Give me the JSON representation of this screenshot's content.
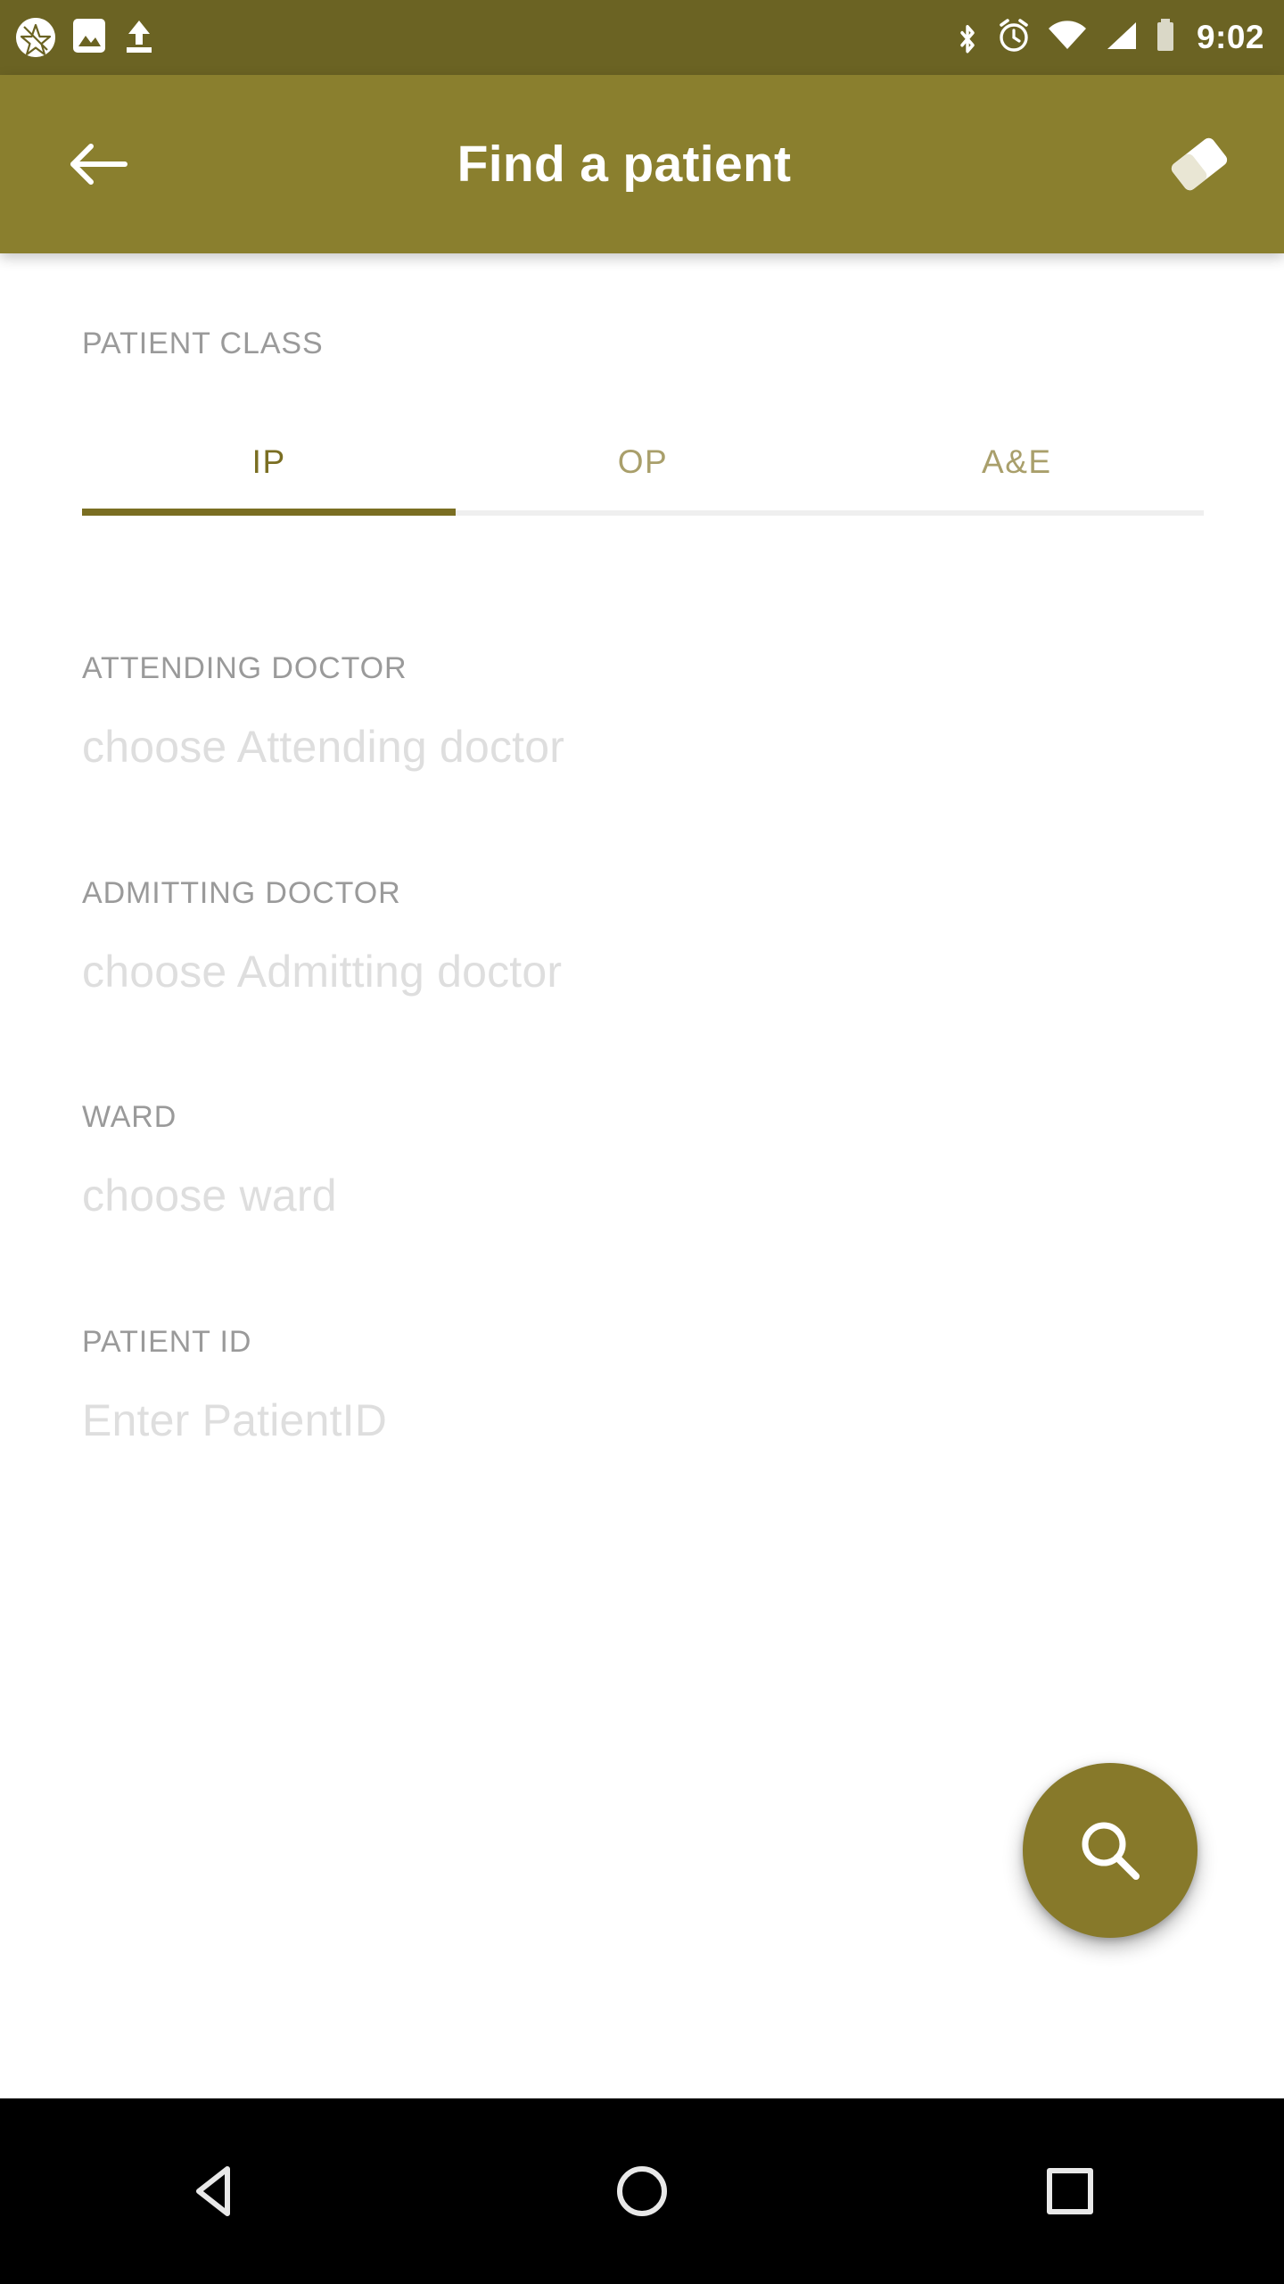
{
  "status_bar": {
    "background_color": "#6B6323",
    "time": "9:02",
    "left_icons": [
      {
        "name": "app-notification-icon",
        "glyph": "star-circle"
      },
      {
        "name": "screenshot-image-icon",
        "glyph": "image"
      },
      {
        "name": "upload-icon",
        "glyph": "upload-arrow"
      }
    ],
    "right_icons": [
      {
        "name": "bluetooth-icon",
        "glyph": "bluetooth"
      },
      {
        "name": "alarm-icon",
        "glyph": "alarm-clock"
      },
      {
        "name": "wifi-icon",
        "glyph": "wifi"
      },
      {
        "name": "cellular-signal-icon",
        "glyph": "signal-bars"
      },
      {
        "name": "battery-icon",
        "glyph": "battery"
      }
    ]
  },
  "app_bar": {
    "background_color": "#8A7F2E",
    "title": "Find a patient",
    "back_label": "Back",
    "clear_label": "Clear"
  },
  "main": {
    "patient_class_label": "PATIENT CLASS",
    "tabs": [
      {
        "label": "IP",
        "selected": true
      },
      {
        "label": "OP",
        "selected": false
      },
      {
        "label": "A&E",
        "selected": false
      }
    ],
    "selected_tab_color": "#7A6E22",
    "unselected_tab_color": "#A99F6B",
    "fields": [
      {
        "label": "ATTENDING DOCTOR",
        "placeholder": "choose Attending doctor",
        "value": ""
      },
      {
        "label": "ADMITTING DOCTOR",
        "placeholder": "choose Admitting doctor",
        "value": ""
      },
      {
        "label": "WARD",
        "placeholder": "choose ward",
        "value": ""
      },
      {
        "label": "PATIENT ID",
        "placeholder": "Enter PatientID",
        "value": ""
      }
    ]
  },
  "fab": {
    "name": "search-fab",
    "icon": "search-icon",
    "color": "#87792A",
    "label": "Search"
  },
  "nav_bar": {
    "background_color": "#000000",
    "buttons": [
      {
        "name": "nav-back-button",
        "icon": "triangle-back-icon",
        "label": "Back"
      },
      {
        "name": "nav-home-button",
        "icon": "circle-home-icon",
        "label": "Home"
      },
      {
        "name": "nav-recents-button",
        "icon": "square-recents-icon",
        "label": "Recents"
      }
    ]
  }
}
